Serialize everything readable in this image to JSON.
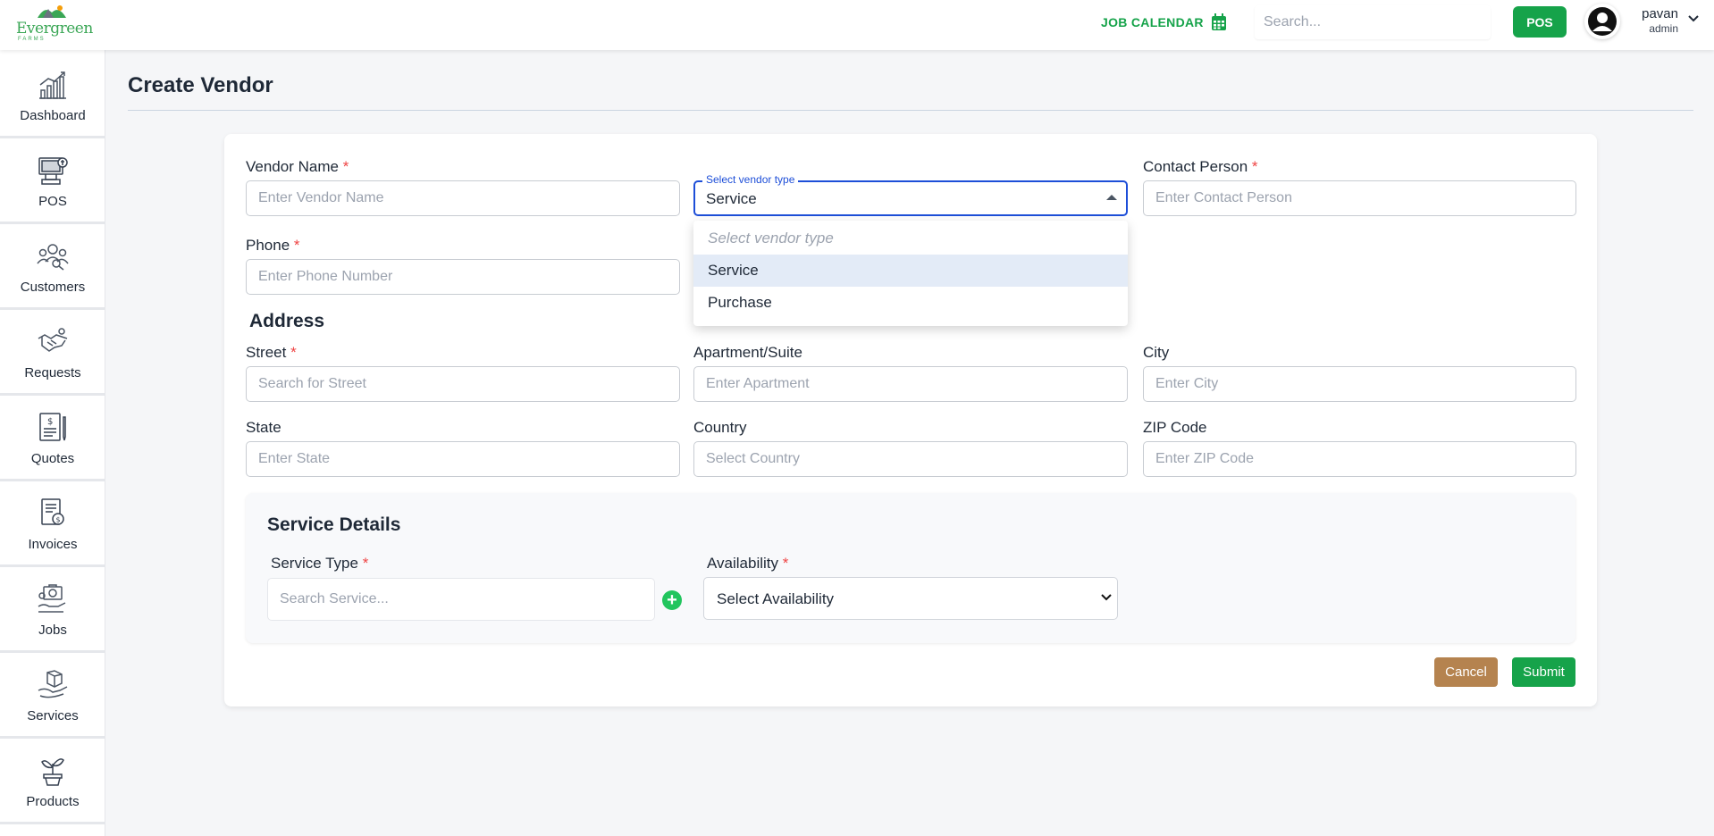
{
  "header": {
    "logo_text": "Evergreen",
    "logo_sub": "FARMS",
    "job_calendar_label": "JOB CALENDAR",
    "search_placeholder": "Search...",
    "pos_label": "POS",
    "user_name": "pavan",
    "user_role": "admin"
  },
  "sidebar": {
    "items": [
      {
        "label": "Dashboard",
        "icon": "bar-chart-icon"
      },
      {
        "label": "POS",
        "icon": "pos-terminal-icon"
      },
      {
        "label": "Customers",
        "icon": "customers-icon"
      },
      {
        "label": "Requests",
        "icon": "handshake-icon"
      },
      {
        "label": "Quotes",
        "icon": "quote-document-icon"
      },
      {
        "label": "Invoices",
        "icon": "invoice-icon"
      },
      {
        "label": "Jobs",
        "icon": "jobs-icon"
      },
      {
        "label": "Services",
        "icon": "services-icon"
      },
      {
        "label": "Products",
        "icon": "plant-icon"
      }
    ]
  },
  "page": {
    "title": "Create Vendor"
  },
  "form": {
    "vendor_name": {
      "label": "Vendor Name",
      "placeholder": "Enter Vendor Name",
      "required": "*"
    },
    "vendor_type": {
      "legend": "Select vendor type",
      "value": "Service",
      "options": [
        "Select vendor type",
        "Service",
        "Purchase"
      ]
    },
    "contact_person": {
      "label": "Contact Person",
      "placeholder": "Enter Contact Person",
      "required": "*"
    },
    "phone": {
      "label": "Phone",
      "placeholder": "Enter Phone Number",
      "required": "*"
    },
    "address_heading": "Address",
    "street": {
      "label": "Street",
      "placeholder": "Search for Street",
      "required": "*"
    },
    "apartment": {
      "label": "Apartment/Suite",
      "placeholder": "Enter Apartment"
    },
    "city": {
      "label": "City",
      "placeholder": "Enter City"
    },
    "state": {
      "label": "State",
      "placeholder": "Enter State"
    },
    "country": {
      "label": "Country",
      "placeholder": "Select Country"
    },
    "zip": {
      "label": "ZIP Code",
      "placeholder": "Enter ZIP Code"
    },
    "service_details": {
      "heading": "Service Details",
      "service_type": {
        "label": "Service Type",
        "placeholder": "Search Service...",
        "required": "*"
      },
      "availability": {
        "label": "Availability",
        "value": "Select Availability",
        "required": "*"
      },
      "add_symbol": "+"
    },
    "cancel_label": "Cancel",
    "submit_label": "Submit"
  },
  "colors": {
    "brand_green": "#16a34a",
    "cancel_brown": "#b5834f",
    "focus_blue": "#1d4ed8",
    "required_red": "#ef4444"
  }
}
